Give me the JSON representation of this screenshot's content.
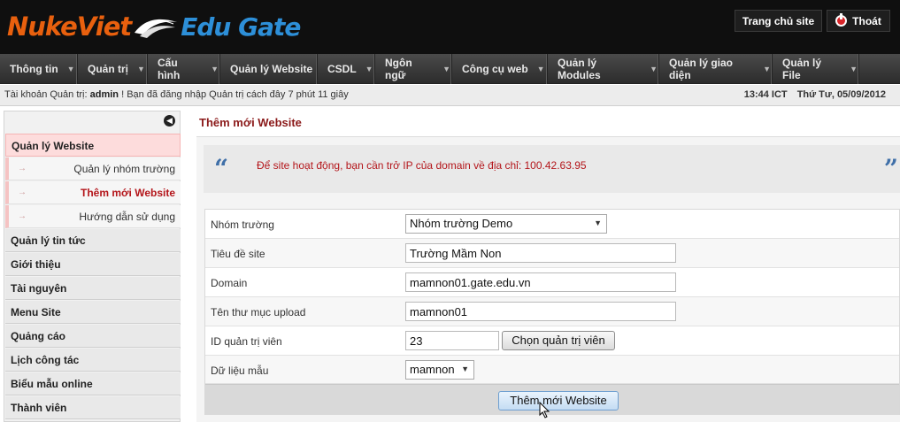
{
  "header": {
    "logo_left": "NukeViet",
    "logo_right": "Edu Gate",
    "home_button": "Trang chủ site",
    "logout_button": "Thoát"
  },
  "nav": {
    "items": [
      {
        "label": "Thông tin",
        "dropdown": true
      },
      {
        "label": "Quản trị",
        "dropdown": true
      },
      {
        "label": "Cấu hình",
        "dropdown": true
      },
      {
        "label": "Quản lý Website",
        "dropdown": false
      },
      {
        "label": "CSDL",
        "dropdown": true
      },
      {
        "label": "Ngôn ngữ",
        "dropdown": true
      },
      {
        "label": "Công cụ web",
        "dropdown": true
      },
      {
        "label": "Quản lý Modules",
        "dropdown": true
      },
      {
        "label": "Quản lý giao diện",
        "dropdown": true
      },
      {
        "label": "Quản lý File",
        "dropdown": true
      }
    ]
  },
  "status": {
    "account_prefix": "Tài khoản Quản trị:",
    "username": "admin",
    "login_info": "! Bạn đã đăng nhập Quản trị cách đây 7 phút 11 giây",
    "time": "13:44 ICT",
    "date": "Thứ Tư, 05/09/2012"
  },
  "sidebar": {
    "section_active": "Quản lý Website",
    "sub_items": [
      {
        "label": "Quản lý nhóm trường",
        "current": false
      },
      {
        "label": "Thêm mới Website",
        "current": true
      },
      {
        "label": "Hướng dẫn sử dụng",
        "current": false
      }
    ],
    "items": [
      {
        "label": "Quản lý tin tức"
      },
      {
        "label": "Giới thiệu"
      },
      {
        "label": "Tài nguyên"
      },
      {
        "label": "Menu Site"
      },
      {
        "label": "Quảng cáo"
      },
      {
        "label": "Lịch công tác"
      },
      {
        "label": "Biểu mẫu online"
      },
      {
        "label": "Thành viên"
      }
    ]
  },
  "main": {
    "title": "Thêm mới Website",
    "notice": "Để site hoạt động, bạn cần trở IP của domain về địa chỉ: 100.42.63.95",
    "form": {
      "group_label": "Nhóm trường",
      "group_value": "Nhóm trường Demo",
      "site_title_label": "Tiêu đề site",
      "site_title_value": "Trường Mầm Non",
      "domain_label": "Domain",
      "domain_value": "mamnon01.gate.edu.vn",
      "upload_label": "Tên thư mục upload",
      "upload_value": "mamnon01",
      "admin_id_label": "ID quản trị viên",
      "admin_id_value": "23",
      "choose_admin_button": "Chọn quản trị viên",
      "sample_data_label": "Dữ liệu mẫu",
      "sample_data_value": "mamnon",
      "submit_button": "Thêm mới Website"
    }
  },
  "colors": {
    "header_bg": "#0f0f0f",
    "logo_orange": "#e8600e",
    "logo_blue": "#2d8fd8",
    "accent_red": "#b4161b",
    "title_dark_red": "#8b1a1a"
  }
}
